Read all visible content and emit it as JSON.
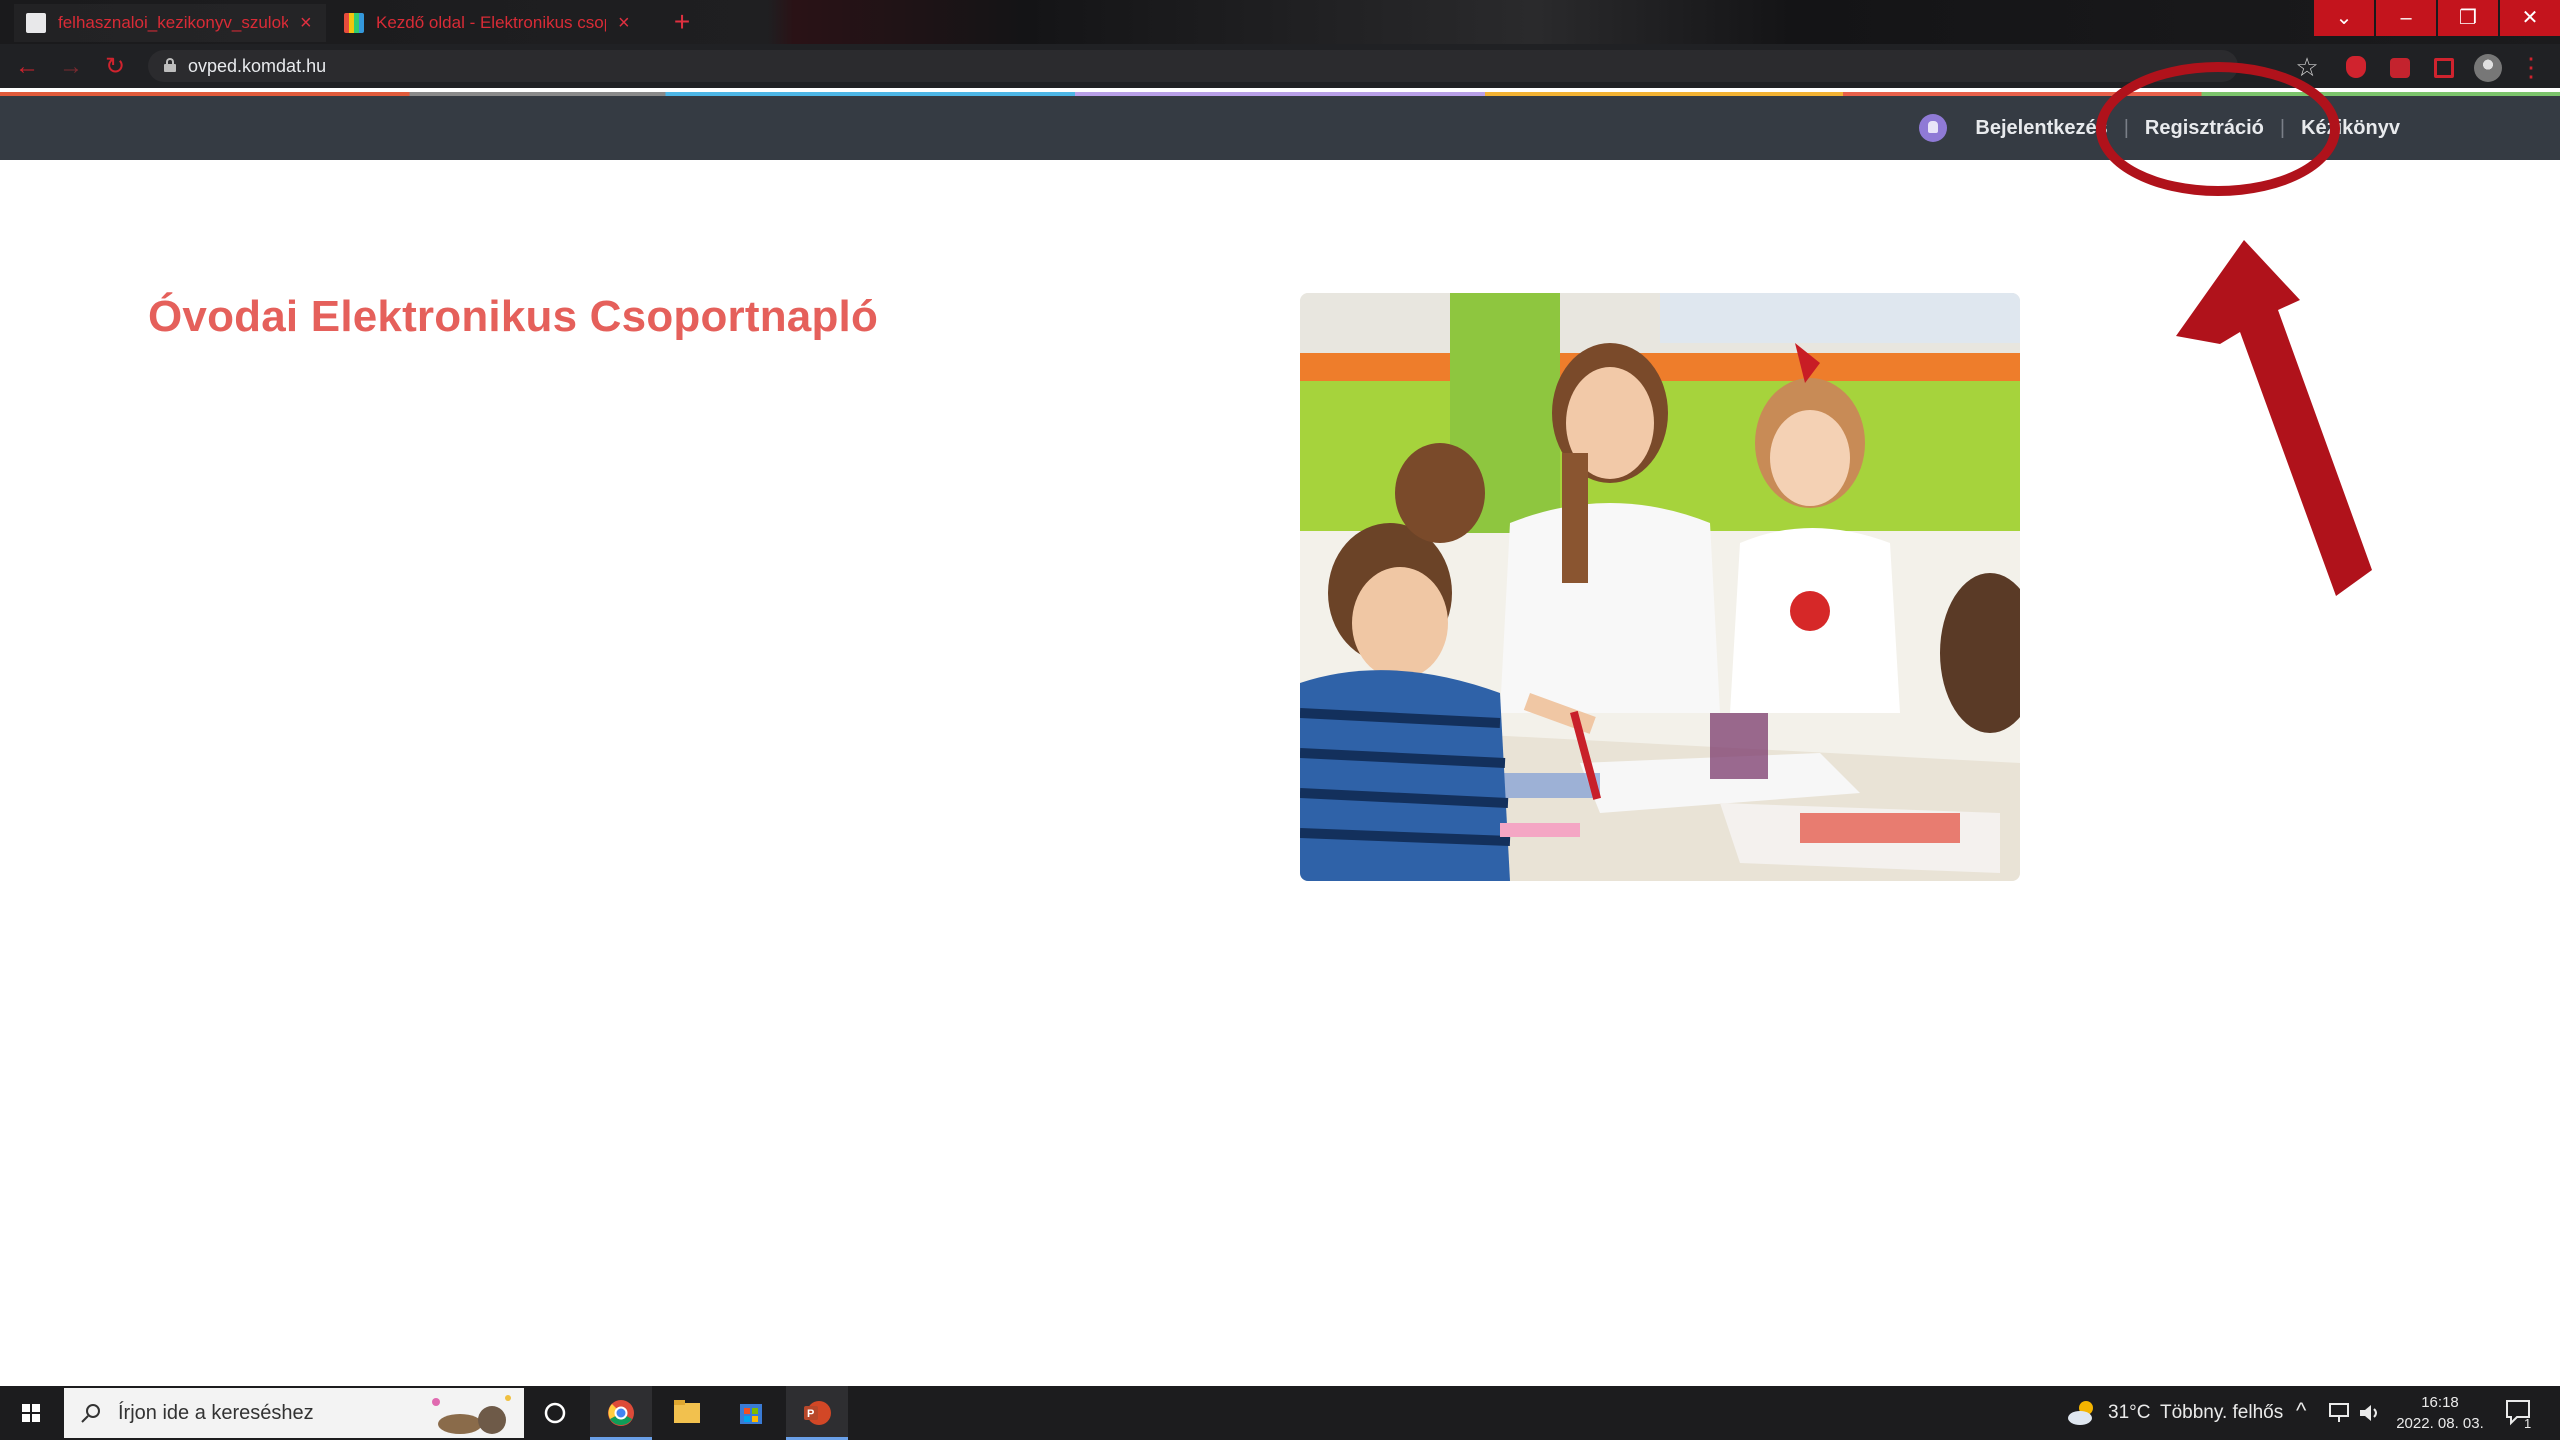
{
  "browser": {
    "tabs": [
      {
        "title": "felhasznaloi_kezikonyv_szuloknek"
      },
      {
        "title": "Kezdő oldal - Elektronikus csoportnapló"
      }
    ],
    "new_tab_symbol": "+",
    "close_symbol": "×",
    "window_controls": {
      "minimize": "–",
      "restore": "❐",
      "close": "✕",
      "dropdown": "⌄"
    },
    "url": "ovped.komdat.hu",
    "nav_symbols": {
      "back": "←",
      "forward": "→",
      "reload": "↻",
      "star": "☆",
      "menu": "⋮"
    }
  },
  "site_nav": {
    "links": [
      {
        "label": "Bejelentkezés"
      },
      {
        "label": "Regisztráció"
      },
      {
        "label": "Kézikönyv"
      }
    ],
    "separator": "|"
  },
  "page": {
    "title": "Óvodai Elektronikus Csoportnapló"
  },
  "taskbar": {
    "search_placeholder": "Írjon ide a kereséshez",
    "weather": {
      "temp": "31°C",
      "condition": "Többny. felhős"
    },
    "time": "16:18",
    "date": "2022. 08. 03.",
    "notification_count": "1"
  },
  "colors": {
    "accent_red": "#e5605b",
    "nav_bg": "#353b43",
    "annotation_red": "#b0121b"
  }
}
